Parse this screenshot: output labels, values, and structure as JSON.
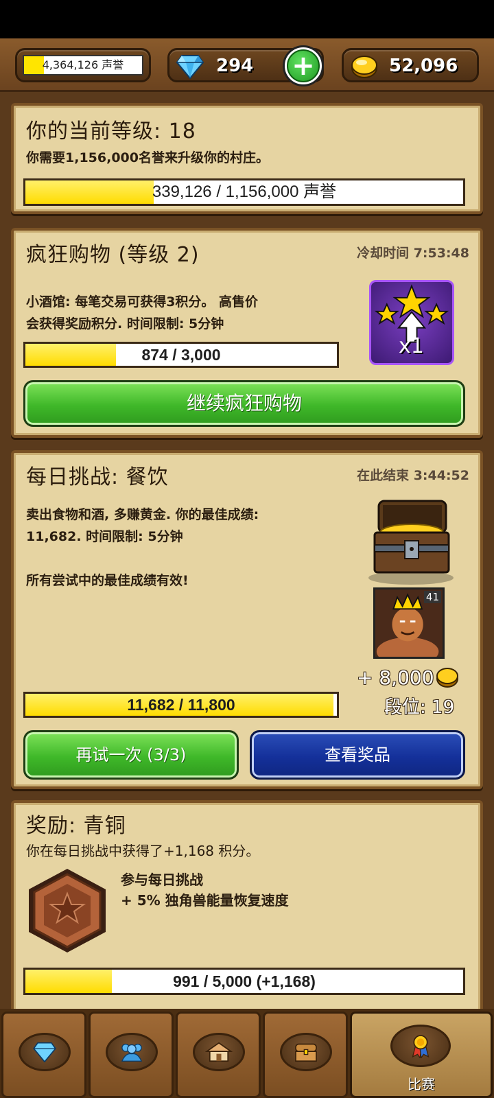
{
  "resources": {
    "prestige_text": "4,364,126 声誉",
    "prestige_fill_fraction": 0.17,
    "gems": "294",
    "gold": "52,096"
  },
  "level_panel": {
    "title": "你的当前等级: 18",
    "description": "你需要1,156,000名誉来升级你的村庄。",
    "progress_text": "339,126 / 1,156,000 声誉",
    "progress_fraction": 0.293
  },
  "shopping_panel": {
    "title": "疯狂购物 (等级 2)",
    "cooldown": "冷却时间 7:53:48",
    "description": "小酒馆: 每笔交易可获得3积分。 高售价\n会获得奖励积分. 时间限制: 5分钟",
    "progress_text": "874 / 3,000",
    "progress_fraction": 0.291,
    "badge_multiplier": "x1",
    "continue_label": "继续疯狂购物"
  },
  "challenge_panel": {
    "title": "每日挑战: 餐饮",
    "ends": "在此结束 3:44:52",
    "description": "卖出食物和酒, 多赚黄金. 你的最佳成绩:\n11,682. 时间限制: 5分钟\n\n所有尝试中的最佳成绩有效!",
    "avatar_level": "41",
    "reward": "+ 8,000",
    "rank": "段位: 19",
    "progress_text": "11,682 / 11,800",
    "progress_fraction": 0.99,
    "retry_label": "再试一次 (3/3)",
    "view_prizes_label": "查看奖品"
  },
  "reward_panel": {
    "title": "奖励: 青铜",
    "description": "你在每日挑战中获得了+1,168 积分。",
    "perk_line1": "参与每日挑战",
    "perk_line2": "+ 5% 独角兽能量恢复速度",
    "progress_text": "991 / 5,000 (+1,168)",
    "progress_fraction": 0.198
  },
  "nav": {
    "active_label": "比赛"
  }
}
